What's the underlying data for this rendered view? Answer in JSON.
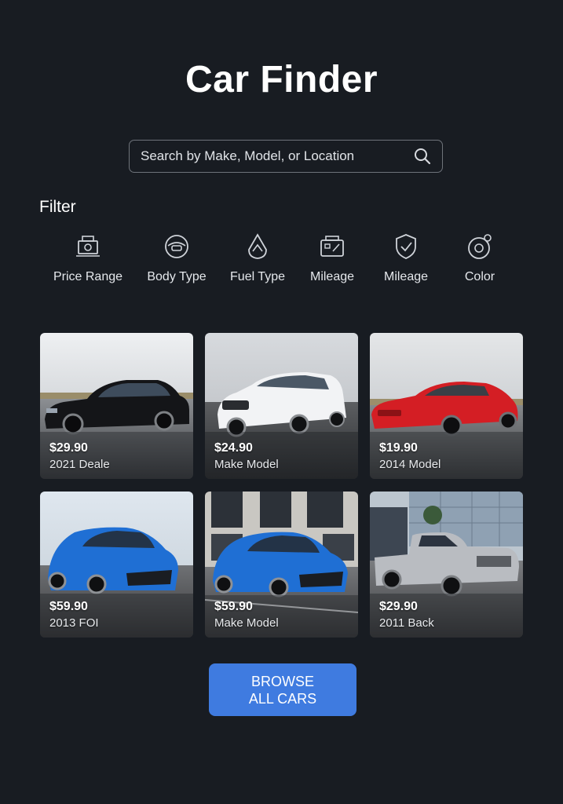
{
  "app": {
    "title": "Car Finder"
  },
  "search": {
    "placeholder": "Search by Make, Model, or Location",
    "value": "",
    "icon": "search-icon"
  },
  "filters": {
    "heading": "Filter",
    "items": [
      {
        "label": "Price Range",
        "icon": "price-tag-icon"
      },
      {
        "label": "Body Type",
        "icon": "body-type-icon"
      },
      {
        "label": "Fuel Type",
        "icon": "fuel-drop-icon"
      },
      {
        "label": "Mileage",
        "icon": "odometer-icon"
      },
      {
        "label": "Mileage",
        "icon": "gauge-icon"
      },
      {
        "label": "Color",
        "icon": "color-palette-icon"
      }
    ]
  },
  "listings": [
    {
      "price": "$29.90",
      "subtitle": "2021 Deale",
      "car": "black-sedan",
      "color": "#141518"
    },
    {
      "price": "$24.90",
      "subtitle": "Make Model",
      "car": "white-suv",
      "color": "#f2f3f5"
    },
    {
      "price": "$19.90",
      "subtitle": "2014 Model",
      "car": "red-sports-car",
      "color": "#d41e24"
    },
    {
      "price": "$59.90",
      "subtitle": "2013 FOI",
      "car": "blue-hatchback",
      "color": "#1f6fd4"
    },
    {
      "price": "$59.90",
      "subtitle": "Make Model",
      "car": "blue-hatchback",
      "color": "#1f6fd4"
    },
    {
      "price": "$29.90",
      "subtitle": "2011 Back",
      "car": "silver-pickup-truck",
      "color": "#b9bcc1"
    }
  ],
  "cta": {
    "line1": "BROWSE",
    "line2": "ALL CARS"
  },
  "colors": {
    "background": "#181c22",
    "accent": "#3f7be0",
    "card_text": "#ffffff"
  }
}
